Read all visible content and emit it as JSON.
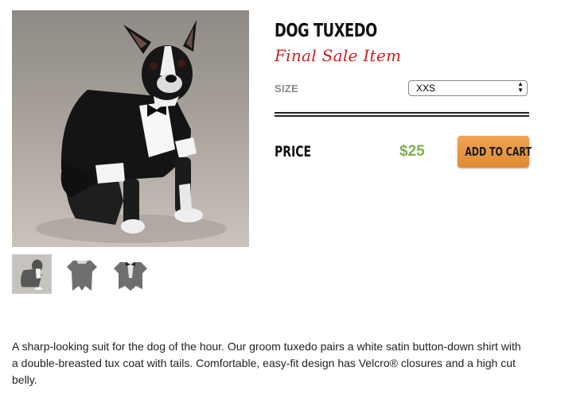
{
  "product": {
    "title": "DOG TUXEDO",
    "sale_label": "Final Sale Item",
    "image_alt": "dog-in-tuxedo-photo"
  },
  "thumbnails": [
    {
      "name": "thumb-dog-photo",
      "selected": true
    },
    {
      "name": "thumb-tuxedo-back",
      "selected": false
    },
    {
      "name": "thumb-tuxedo-front",
      "selected": false
    }
  ],
  "options": {
    "size_label": "SIZE",
    "size_selected": "XXS"
  },
  "pricing": {
    "price_label": "PRICE",
    "price_value": "$25",
    "price_color": "#7fb04a"
  },
  "actions": {
    "add_to_cart_label": "ADD TO CART",
    "button_color": "#e8943f"
  },
  "description": "A sharp-looking suit for the dog of the hour. Our groom tuxedo pairs a white satin button-down shirt with a double-breasted tux coat with tails. Comfortable, easy-fit design has Velcro® closures and a high cut belly."
}
